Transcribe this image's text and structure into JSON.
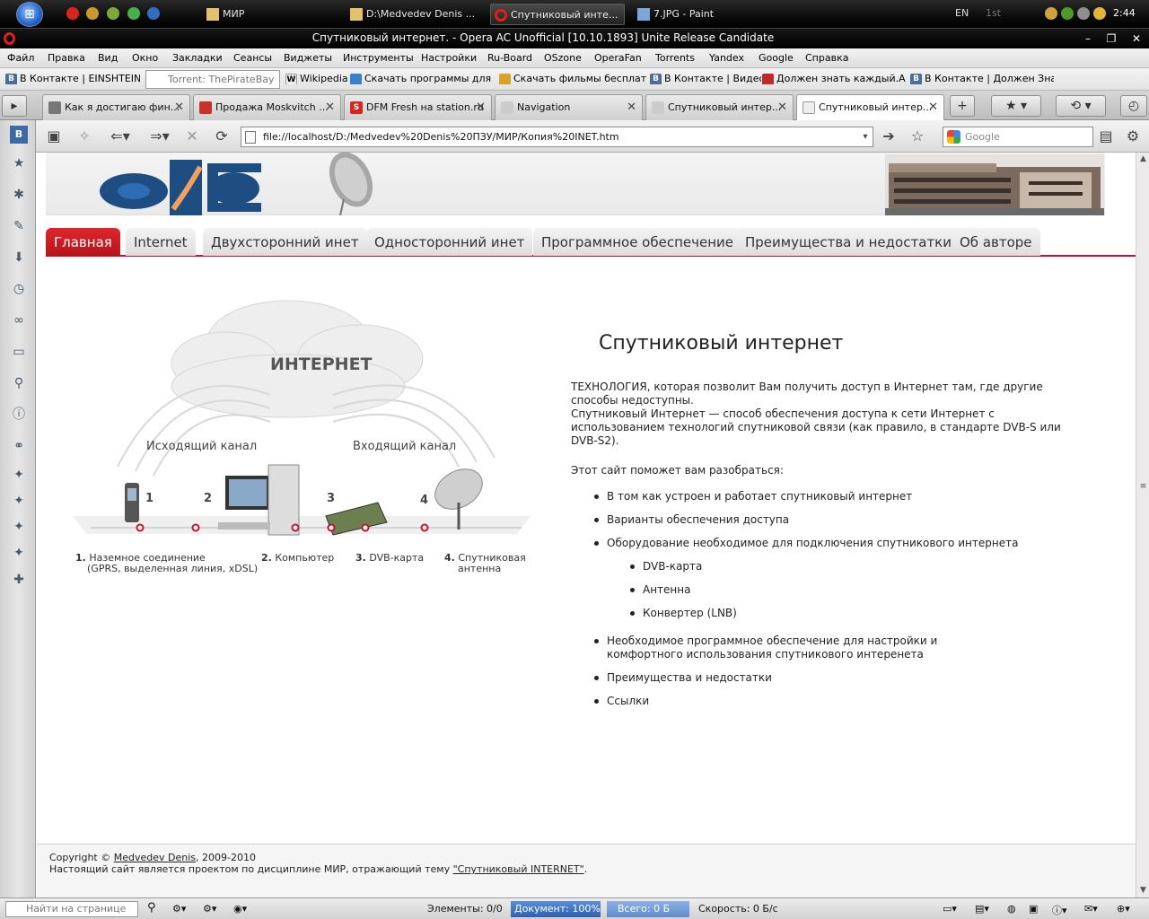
{
  "taskbar": {
    "tasks": [
      {
        "label": "МИР"
      },
      {
        "label": "D:\\Medvedev Denis ..."
      },
      {
        "label": "Спутниковый инте..."
      },
      {
        "label": "7.JPG - Paint"
      }
    ],
    "lang": "EN",
    "indicator": "1st",
    "clock": "2:44"
  },
  "window": {
    "title": "Спутниковый интернет. - Opera AC Unofficial [10.10.1893] Unite Release Candidate"
  },
  "menu": [
    "Файл",
    "Правка",
    "Вид",
    "Окно",
    "Закладки",
    "Сеансы",
    "Виджеты",
    "Инструменты",
    "Настройки",
    "Ru-Board",
    "OSzone",
    "OperaFan",
    "Torrents",
    "Yandex",
    "Google",
    "Справка"
  ],
  "bookmarks": [
    "В Контакте | EINSHTEIN -)",
    "Torrent: ThePirateBay",
    "Wikipedia",
    "Скачать программы для ...",
    "Скачать фильмы бесплат...",
    "В Контакте | Видео",
    "Должен знать каждый.А...",
    "В Контакте | Должен Зна..."
  ],
  "tabs": [
    {
      "label": "Как я достигаю фин..."
    },
    {
      "label": "Продажа Moskvitch ..."
    },
    {
      "label": "DFM Fresh на station.ru"
    },
    {
      "label": "Navigation"
    },
    {
      "label": "Спутниковый интер..."
    },
    {
      "label": "Спутниковый интер..."
    }
  ],
  "nav": {
    "address": "file://localhost/D:/Medvedev%20Denis%20ПЗУ/МИР/Копия%20INET.htm",
    "search_placeholder": "Google"
  },
  "site": {
    "nav_tabs": [
      "Главная",
      "Internet",
      "Двухсторонний инет",
      "Односторонний инет",
      "Программное обеспечение",
      "Преимущества и недостатки",
      "Об авторе"
    ],
    "diagram": {
      "cloud_label": "ИНТЕРНЕТ",
      "outgoing": "Исходящий канал",
      "incoming": "Входящий канал",
      "num1": "1",
      "num2": "2",
      "num3": "3",
      "num4": "4",
      "cap1_num": "1.",
      "cap1": "Наземное соединение",
      "cap1_sub": "(GPRS, выделенная линия, xDSL)",
      "cap2_num": "2.",
      "cap2": "Компьютер",
      "cap3_num": "3.",
      "cap3": "DVB-карта",
      "cap4_num": "4.",
      "cap4": "Спутниковая",
      "cap4_sub": "антенна"
    },
    "heading": "Спутниковый интернет",
    "para1a": "ТЕХНОЛОГИЯ, которая позволит Вам получить доступ в Интернет там, где другие способы недоступны.",
    "para1b": "Спутниковый Интернет — способ обеспечения доступа к сети Интернет с использованием технологий спутниковой связи (как правило, в стандарте DVB-S или DVB-S2).",
    "para2": "Этот сайт поможет вам разобраться:",
    "list": [
      "В том как устроен и работает спутниковый интернет",
      "Варианты обеспечения доступа",
      "Оборудование необходимое для подключения спутникового интернета"
    ],
    "sublist": [
      "DVB-карта",
      "Антенна",
      "Конвертер (LNB)"
    ],
    "list2": [
      "Необходимое программное обеспечение для настройки и комфортного использования спутникового интеренета",
      "Преимущества и недостатки",
      "Ссылки"
    ],
    "footer": {
      "copyright_prefix": "Copyright ©",
      "author": "Medvedev Denis",
      "copyright_suffix": ", 2009-2010",
      "line2_prefix": "Настоящий сайт является проектом по дисциплине МИР, отражающий тему",
      "topic": "\"Спутниковый INTERNET\"",
      "line2_suffix": "."
    }
  },
  "status": {
    "find_placeholder": "Найти на странице",
    "elements": "Элементы:  0/0",
    "document": "Документ:  100%",
    "document_progress": 1.0,
    "total": "Всего:  0 Б",
    "speed": "Скорость:  0 Б/с"
  },
  "colors": {
    "accent": "#c8102e",
    "opera_red": "#e0201b"
  }
}
